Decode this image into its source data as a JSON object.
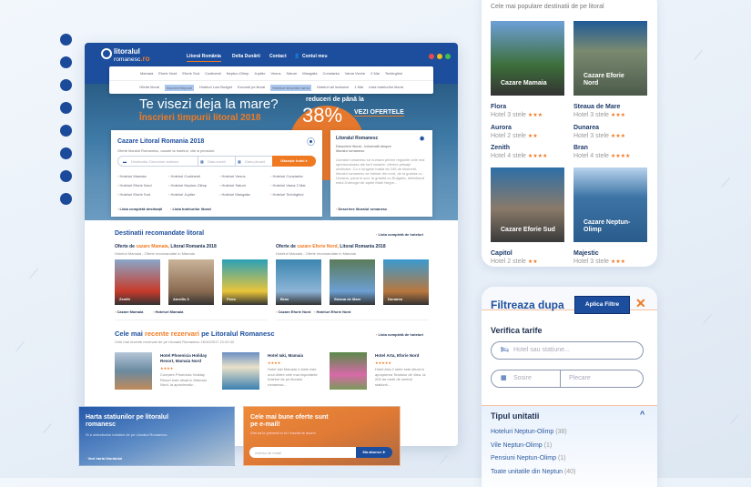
{
  "site": {
    "logo_line1": "litoralul",
    "logo_line2": "romanesc",
    "logo_tld": ".ro",
    "main_nav": [
      "Litoral România",
      "Delta Dunării",
      "Contact",
      "Contul meu"
    ],
    "destinations_nav": [
      "Mamaia",
      "Eforie Nord",
      "Eforie Sud",
      "Costinesti",
      "Neptun-Olimp",
      "Jupiter",
      "Venus",
      "Saturn",
      "Mangalia",
      "Constanta",
      "Vama Veche",
      "2 Mai",
      "Techirghiol"
    ],
    "offers_nav": [
      "Oferte litoral",
      "Inscrieri timpurii",
      "Hoteluri Low Budget",
      "Excursii pe litoral",
      "Hoteluri deschise iarna",
      "Hoteluri all inclusive",
      "1 Mai",
      "Lista hotelurilor litoral"
    ],
    "hero": {
      "title": "Te visezi deja la mare?",
      "subtitle": "Înscrieri timpurii litoral 2018",
      "discount_label": "reduceri de până la",
      "discount": "38%",
      "cta": "VEZI OFERTELE"
    },
    "search": {
      "title": "Cazare Litoral Romania 2018",
      "subtitle": "Oferte litoralul Romanesc, cazare la hoteluri, vile si pensiuni.",
      "destination_placeholder": "Destinatia: Denumire statiune",
      "checkin_placeholder": "Data sosirii",
      "checkout_placeholder": "Data plecarii",
      "button": "Găsește hotel",
      "links": [
        "Hoteluri Mamaia",
        "Hoteluri Costinesti",
        "Hoteluri Venus",
        "Hoteluri Constanta",
        "Hoteluri Eforie Nord",
        "Hoteluri Neptun-Olimp",
        "Hoteluri Saturn",
        "Hoteluri Vama 2 Mai",
        "Hoteluri Eforie Sud",
        "Hoteluri Jupiter",
        "Hoteluri Mangalia",
        "Hoteluri Techirghiol"
      ],
      "footer_links": [
        "Lista completă destinații",
        "Lista hotelurilor litoral"
      ]
    },
    "about": {
      "title": "Litoralul Romanesc",
      "subtitle": "Descriere litoral - informatii despre litoralul romanesc",
      "text": "Litoralul romanesc se numara printre regiunile cele mai spectaculoase ale tarii noastre, oferind peisaje uimitoare. Cu o lungime totala de 245 de kilometri, litoralul romanesc se intinde din nord, de la granita cu Ucraina, pana in sud, la granita cu Bulgaria, delimitand estul Dobrogei de apele Marii Negre...",
      "link": "Descriere litoralul romanesc"
    },
    "recommended": {
      "title": "Destinatii recomandate litoral",
      "full_list": "Lista completă de hoteluri",
      "groups": [
        {
          "pre": "Oferte de ",
          "hl": "cazare Mamaia,",
          "post": " Litoral Romania 2018",
          "sub": "Hoteluri Mamaia - Oferte recomandate in Mamaia",
          "hotels": [
            "Zenith",
            "Amellis 3",
            "Flora"
          ],
          "links": [
            "Cazare Mamaia",
            "Hoteluri Mamaia"
          ]
        },
        {
          "pre": "Oferte de ",
          "hl": "cazare Eforie Nord,",
          "post": " Litoral Romania 2018",
          "sub": "Hoteluri Mamaia - Oferte recomandate in Mamaia",
          "hotels": [
            "Bran",
            "Steaua de Mare",
            "Dunarea"
          ],
          "links": [
            "Cazare Eforie Nord",
            "Hoteluri Eforie Nord"
          ]
        }
      ]
    },
    "recent": {
      "pre": "Cele mai ",
      "hl": "recente rezervari",
      "post": " pe Litoralul Romanesc",
      "sub": "Cele mai recente rezervari de pe Litoralul Romanesc 16/10/2017 21:02:42",
      "full_list": "Lista completă de hoteluri",
      "items": [
        {
          "name": "Hotel Phoenicia Holiday Resort, Mamaia Nord",
          "stars": "★★★★",
          "desc": "Complex Phoenicia Holiday Resort este situat in Mamaia Nord, la aproximativ..."
        },
        {
          "name": "Hotel Iaki, Mamaia",
          "stars": "★★★★",
          "desc": "Hotel Iaki Mamaia 4 stele este unul dintre cele mai importante hoteluri de pe litoralul romanesc..."
        },
        {
          "name": "Hotel Arta, Eforie Nord",
          "stars": "★★★★★",
          "desc": "Hotel Arta 2 stele este situat in apropierea Teatrului de Vara, la 200 de metri de centrul statiunii..."
        }
      ]
    },
    "map_banner": {
      "title": "Harta statiunilor pe litoralul romanesc",
      "sub": "Si a obiectivelor turistice de pe Litoralul Romanesc",
      "link": "Vezi harta litoralului"
    },
    "email_banner": {
      "title": "Cele mai bune oferte sunt pe e-mail!",
      "sub": "Vrei sa le primesti si tu? Inscrie-te acum!",
      "placeholder": "Adresa de email",
      "button": "Ma abonez"
    }
  },
  "popular": {
    "subtitle": "Cele mai populare destinatii de pe litoral",
    "destinations": [
      {
        "label": "Cazare Mamaia",
        "hotels": [
          {
            "name": "Flora",
            "cls": "Hotel 3 stele",
            "stars": "★★★"
          },
          {
            "name": "Aurora",
            "cls": "Hotel 2 stele",
            "stars": "★★"
          },
          {
            "name": "Zenith",
            "cls": "Hotel 4 stele",
            "stars": "★★★★"
          }
        ]
      },
      {
        "label": "Cazare Eforie Nord",
        "hotels": [
          {
            "name": "Steaua de Mare",
            "cls": "Hotel 3 stele",
            "stars": "★★★"
          },
          {
            "name": "Dunarea",
            "cls": "Hotel 3 stele",
            "stars": "★★★"
          },
          {
            "name": "Bran",
            "cls": "Hotel 4 stele",
            "stars": "★★★★"
          }
        ]
      },
      {
        "label": "Cazare Eforie Sud",
        "hotels": [
          {
            "name": "Capitol",
            "cls": "Hotel 2 stele",
            "stars": "★★"
          }
        ]
      },
      {
        "label": "Cazare Neptun-Olimp",
        "hotels": [
          {
            "name": "Majestic",
            "cls": "Hotel 3 stele",
            "stars": "★★★"
          }
        ]
      }
    ]
  },
  "filter": {
    "title": "Filtreaza dupa",
    "apply": "Aplica Filtre",
    "section": "Verifica tarife",
    "hotel_placeholder": "Hotel sau stațiune...",
    "arrival": "Sosire",
    "departure": "Plecare",
    "unit_type": "Tipul unitatii",
    "types": [
      {
        "label": "Hoteluri Neptun-Olimp",
        "count": "(38)"
      },
      {
        "label": "Vile Neptun-Olimp",
        "count": "(1)"
      },
      {
        "label": "Pensiuni Neptun-Olimp",
        "count": "(1)"
      },
      {
        "label": "Toate unitatile din Neptun",
        "count": "(40)"
      }
    ]
  },
  "colors": {
    "brand_blue": "#1c4e9d",
    "accent_orange": "#f07a22"
  }
}
